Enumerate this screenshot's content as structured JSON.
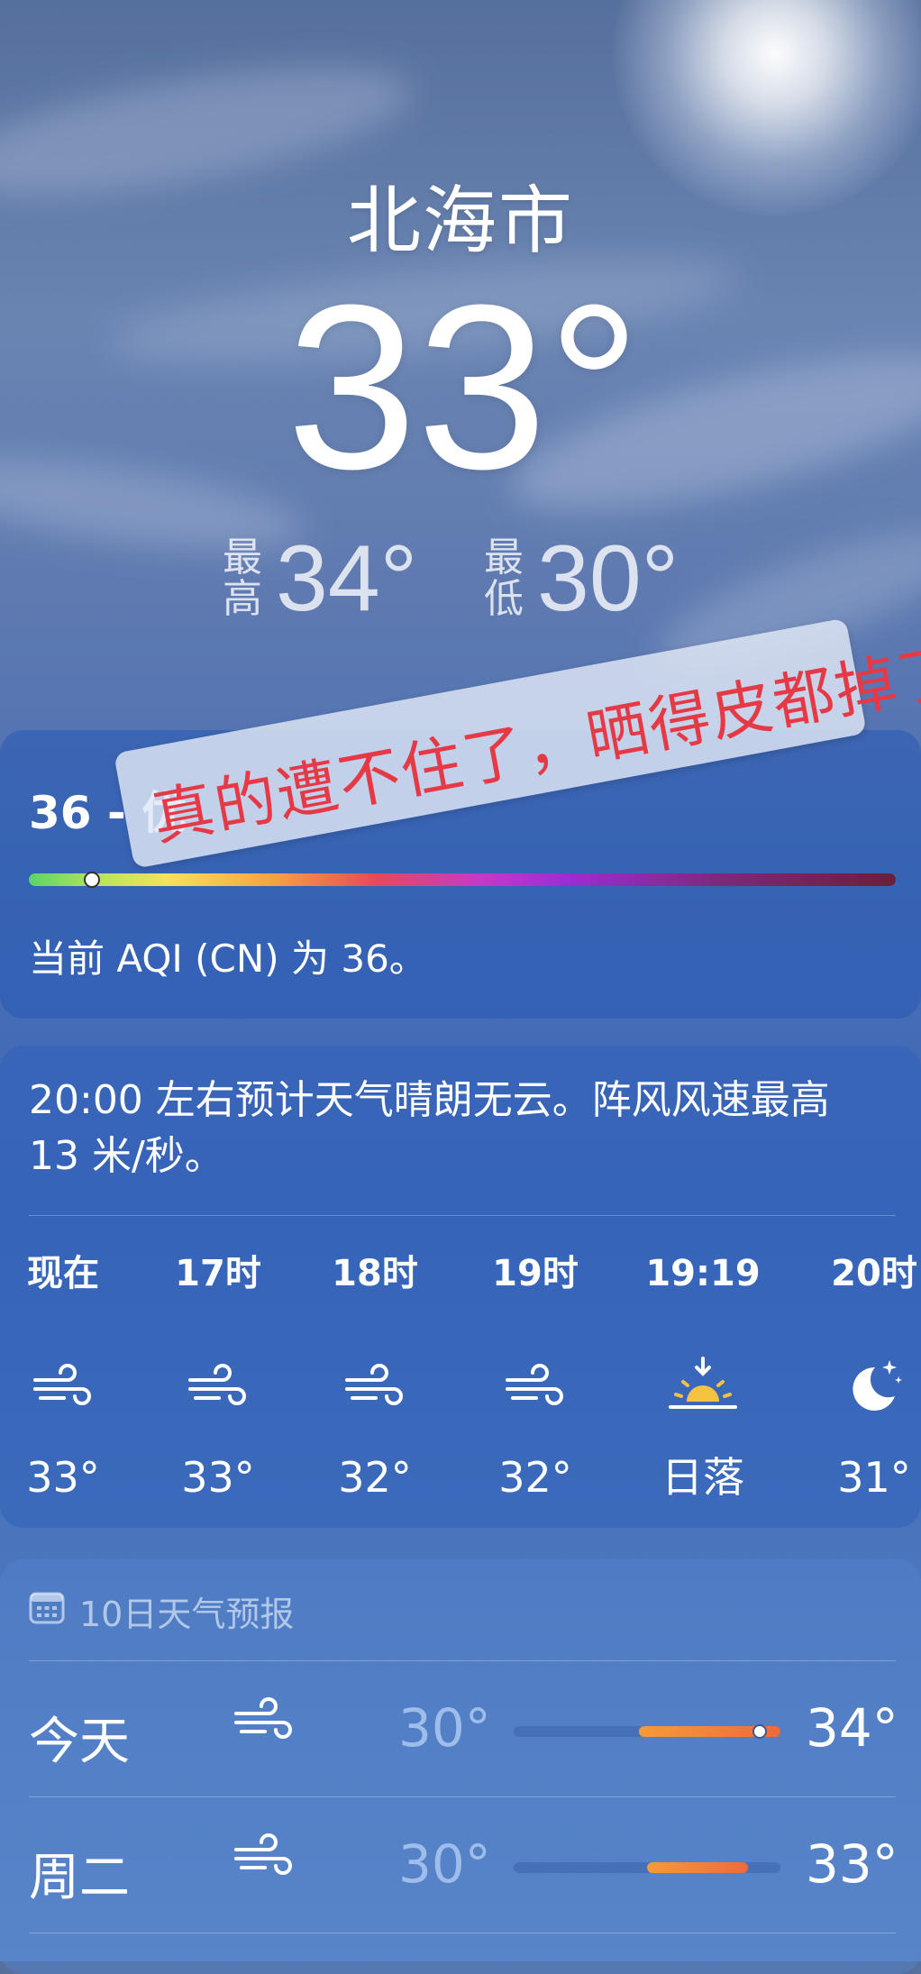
{
  "header": {
    "city": "北海市",
    "current_temp": "33°",
    "high_label": "最高",
    "high_value": "34°",
    "low_label": "最低",
    "low_value": "30°"
  },
  "aqi": {
    "title": "36 - 优",
    "value": 36,
    "description": "当前 AQI (CN) 为 36。"
  },
  "sticker": {
    "text": "真的遭不住了，晒得皮都掉了",
    "color": "#e63946"
  },
  "hourly": {
    "summary": "20:00 左右预计天气晴朗无云。阵风风速最高 13 米/秒。",
    "items": [
      {
        "label": "现在",
        "icon": "wind-icon",
        "temp": "33°"
      },
      {
        "label": "17时",
        "icon": "wind-icon",
        "temp": "33°"
      },
      {
        "label": "18时",
        "icon": "wind-icon",
        "temp": "32°"
      },
      {
        "label": "19时",
        "icon": "wind-icon",
        "temp": "32°"
      },
      {
        "label": "19:19",
        "icon": "sunset-icon",
        "temp": "日落"
      },
      {
        "label": "20时",
        "icon": "moon-stars-icon",
        "temp": "31°"
      }
    ]
  },
  "daily": {
    "header": "10日天气预报",
    "header_icon": "calendar-icon",
    "days": [
      {
        "name": "今天",
        "icon": "wind-icon",
        "low": "30°",
        "high": "34°",
        "range_start": 0.47,
        "range_end": 1.0,
        "current": 0.92
      },
      {
        "name": "周二",
        "icon": "wind-icon",
        "low": "30°",
        "high": "33°",
        "range_start": 0.5,
        "range_end": 0.88
      }
    ]
  },
  "colors": {
    "accent_sunset": "#f5c242",
    "range_bar": "#ee6a3c"
  }
}
